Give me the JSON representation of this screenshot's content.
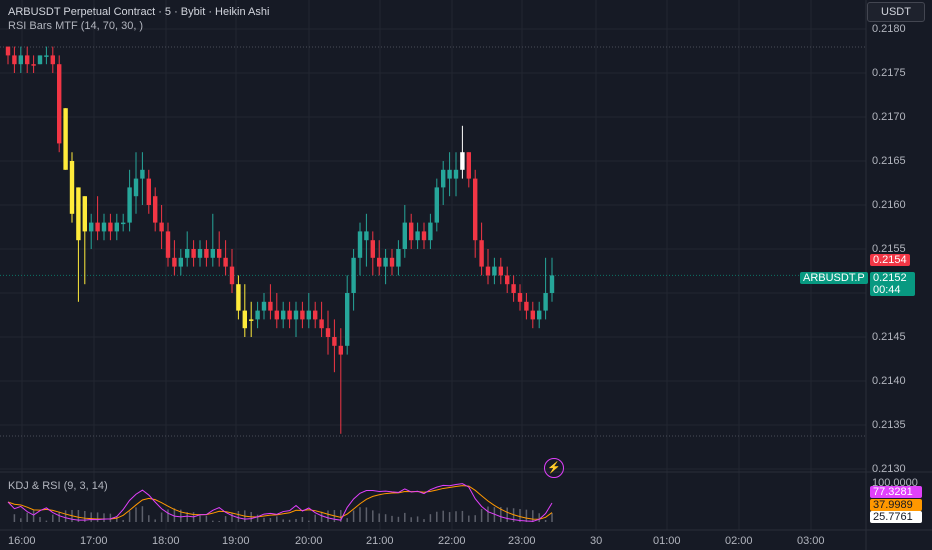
{
  "header": {
    "title": "ARBUSDT Perpetual Contract · 5 · Bybit · Heikin Ashi",
    "indicator": "RSI Bars MTF (14, 70, 30, )"
  },
  "currency_button": "USDT",
  "price_axis": {
    "labels": [
      "0.2180",
      "0.2175",
      "0.2170",
      "0.2165",
      "0.2160",
      "0.2155",
      "0.2150",
      "0.2145",
      "0.2140",
      "0.2135",
      "0.2130"
    ],
    "levels": [
      0.218,
      0.2175,
      0.217,
      0.2165,
      0.216,
      0.2155,
      0.215,
      0.2145,
      0.214,
      0.2135,
      0.213
    ]
  },
  "tags": {
    "red_price": "0.2154",
    "symbol": "ARBUSDT.P",
    "current_price": "0.2152",
    "countdown": "00:44"
  },
  "kdj": {
    "title": "KDJ & RSI (9, 3, 14)",
    "labels": [
      "100.0000",
      "77.3281",
      "37.9989",
      "25.7761"
    ]
  },
  "time_axis": [
    "16:00",
    "17:00",
    "18:00",
    "19:00",
    "20:00",
    "21:00",
    "22:00",
    "23:00",
    "30",
    "01:00",
    "02:00",
    "03:00"
  ],
  "colors": {
    "background": "#161a25",
    "bull": "#26a69a",
    "bear": "#f23645",
    "yellow": "#ffeb3b",
    "white": "#ffffff",
    "k_line": "#e040fb",
    "d_line": "#ff9800"
  },
  "chart_data": {
    "type": "candlestick",
    "timeframe": "5",
    "price_range": [
      0.213,
      0.2181
    ],
    "candles": [
      {
        "o": 0.2177,
        "h": 0.2178,
        "l": 0.2176,
        "c": 0.2178,
        "color": "bear"
      },
      {
        "o": 0.2177,
        "h": 0.2178,
        "l": 0.2175,
        "c": 0.2176,
        "color": "bear"
      },
      {
        "o": 0.2176,
        "h": 0.2178,
        "l": 0.2175,
        "c": 0.2177,
        "color": "bull"
      },
      {
        "o": 0.2177,
        "h": 0.2178,
        "l": 0.2175,
        "c": 0.2176,
        "color": "bear"
      },
      {
        "o": 0.2176,
        "h": 0.2177,
        "l": 0.2175,
        "c": 0.2176,
        "color": "bear"
      },
      {
        "o": 0.2176,
        "h": 0.2177,
        "l": 0.2176,
        "c": 0.2177,
        "color": "bull"
      },
      {
        "o": 0.2177,
        "h": 0.2178,
        "l": 0.2176,
        "c": 0.2177,
        "color": "bull"
      },
      {
        "o": 0.2177,
        "h": 0.2178,
        "l": 0.2175,
        "c": 0.2176,
        "color": "bear"
      },
      {
        "o": 0.2176,
        "h": 0.2177,
        "l": 0.2166,
        "c": 0.2167,
        "color": "bear"
      },
      {
        "o": 0.2171,
        "h": 0.2171,
        "l": 0.2164,
        "c": 0.2164,
        "color": "yellow"
      },
      {
        "o": 0.2165,
        "h": 0.2166,
        "l": 0.2158,
        "c": 0.2159,
        "color": "yellow"
      },
      {
        "o": 0.2162,
        "h": 0.2162,
        "l": 0.2149,
        "c": 0.2156,
        "color": "yellow"
      },
      {
        "o": 0.2161,
        "h": 0.2161,
        "l": 0.2151,
        "c": 0.2157,
        "color": "yellow"
      },
      {
        "o": 0.2157,
        "h": 0.2159,
        "l": 0.2155,
        "c": 0.2158,
        "color": "bull"
      },
      {
        "o": 0.2158,
        "h": 0.2161,
        "l": 0.2156,
        "c": 0.2157,
        "color": "bear"
      },
      {
        "o": 0.2157,
        "h": 0.2159,
        "l": 0.2156,
        "c": 0.2158,
        "color": "bull"
      },
      {
        "o": 0.2158,
        "h": 0.2159,
        "l": 0.2156,
        "c": 0.2157,
        "color": "bear"
      },
      {
        "o": 0.2157,
        "h": 0.2159,
        "l": 0.2156,
        "c": 0.2158,
        "color": "bull"
      },
      {
        "o": 0.2158,
        "h": 0.2159,
        "l": 0.2157,
        "c": 0.2158,
        "color": "bull"
      },
      {
        "o": 0.2158,
        "h": 0.2164,
        "l": 0.2157,
        "c": 0.2162,
        "color": "bull"
      },
      {
        "o": 0.2161,
        "h": 0.2166,
        "l": 0.2159,
        "c": 0.2163,
        "color": "bull"
      },
      {
        "o": 0.2163,
        "h": 0.2166,
        "l": 0.216,
        "c": 0.2164,
        "color": "bull"
      },
      {
        "o": 0.2163,
        "h": 0.2164,
        "l": 0.2159,
        "c": 0.216,
        "color": "bear"
      },
      {
        "o": 0.2161,
        "h": 0.2162,
        "l": 0.2157,
        "c": 0.2158,
        "color": "bear"
      },
      {
        "o": 0.2158,
        "h": 0.216,
        "l": 0.2155,
        "c": 0.2157,
        "color": "bear"
      },
      {
        "o": 0.2157,
        "h": 0.2158,
        "l": 0.2153,
        "c": 0.2154,
        "color": "bear"
      },
      {
        "o": 0.2154,
        "h": 0.2156,
        "l": 0.2152,
        "c": 0.2153,
        "color": "bear"
      },
      {
        "o": 0.2153,
        "h": 0.2155,
        "l": 0.2152,
        "c": 0.2154,
        "color": "bull"
      },
      {
        "o": 0.2154,
        "h": 0.2157,
        "l": 0.2153,
        "c": 0.2155,
        "color": "bull"
      },
      {
        "o": 0.2155,
        "h": 0.2156,
        "l": 0.2153,
        "c": 0.2154,
        "color": "bear"
      },
      {
        "o": 0.2154,
        "h": 0.2156,
        "l": 0.2153,
        "c": 0.2155,
        "color": "bull"
      },
      {
        "o": 0.2155,
        "h": 0.2156,
        "l": 0.2153,
        "c": 0.2154,
        "color": "bear"
      },
      {
        "o": 0.2154,
        "h": 0.2159,
        "l": 0.2153,
        "c": 0.2155,
        "color": "bull"
      },
      {
        "o": 0.2155,
        "h": 0.2157,
        "l": 0.2153,
        "c": 0.2154,
        "color": "bear"
      },
      {
        "o": 0.2154,
        "h": 0.2156,
        "l": 0.2152,
        "c": 0.2153,
        "color": "bear"
      },
      {
        "o": 0.2153,
        "h": 0.2155,
        "l": 0.215,
        "c": 0.2151,
        "color": "bear"
      },
      {
        "o": 0.2151,
        "h": 0.2152,
        "l": 0.2147,
        "c": 0.2148,
        "color": "yellow"
      },
      {
        "o": 0.2148,
        "h": 0.2151,
        "l": 0.2145,
        "c": 0.2146,
        "color": "yellow"
      },
      {
        "o": 0.2147,
        "h": 0.2149,
        "l": 0.2145,
        "c": 0.2147,
        "color": "yellow"
      },
      {
        "o": 0.2147,
        "h": 0.2149,
        "l": 0.2146,
        "c": 0.2148,
        "color": "bull"
      },
      {
        "o": 0.2148,
        "h": 0.215,
        "l": 0.2147,
        "c": 0.2149,
        "color": "bull"
      },
      {
        "o": 0.2149,
        "h": 0.2151,
        "l": 0.2147,
        "c": 0.2148,
        "color": "bear"
      },
      {
        "o": 0.2148,
        "h": 0.215,
        "l": 0.2146,
        "c": 0.2147,
        "color": "bear"
      },
      {
        "o": 0.2147,
        "h": 0.2149,
        "l": 0.2146,
        "c": 0.2148,
        "color": "bull"
      },
      {
        "o": 0.2148,
        "h": 0.2149,
        "l": 0.2146,
        "c": 0.2147,
        "color": "bear"
      },
      {
        "o": 0.2147,
        "h": 0.2149,
        "l": 0.2145,
        "c": 0.2148,
        "color": "bull"
      },
      {
        "o": 0.2148,
        "h": 0.2149,
        "l": 0.2146,
        "c": 0.2147,
        "color": "bear"
      },
      {
        "o": 0.2147,
        "h": 0.215,
        "l": 0.2146,
        "c": 0.2148,
        "color": "bull"
      },
      {
        "o": 0.2148,
        "h": 0.2149,
        "l": 0.2146,
        "c": 0.2147,
        "color": "bear"
      },
      {
        "o": 0.2147,
        "h": 0.2149,
        "l": 0.2145,
        "c": 0.2146,
        "color": "bear"
      },
      {
        "o": 0.2146,
        "h": 0.2148,
        "l": 0.2143,
        "c": 0.2145,
        "color": "bear"
      },
      {
        "o": 0.2145,
        "h": 0.2147,
        "l": 0.2141,
        "c": 0.2144,
        "color": "bear"
      },
      {
        "o": 0.2144,
        "h": 0.2146,
        "l": 0.2134,
        "c": 0.2143,
        "color": "bear"
      },
      {
        "o": 0.2144,
        "h": 0.2152,
        "l": 0.2143,
        "c": 0.215,
        "color": "bull"
      },
      {
        "o": 0.215,
        "h": 0.2155,
        "l": 0.2148,
        "c": 0.2154,
        "color": "bull"
      },
      {
        "o": 0.2154,
        "h": 0.2158,
        "l": 0.2152,
        "c": 0.2157,
        "color": "bull"
      },
      {
        "o": 0.2157,
        "h": 0.2159,
        "l": 0.2153,
        "c": 0.2156,
        "color": "bull"
      },
      {
        "o": 0.2156,
        "h": 0.2157,
        "l": 0.2152,
        "c": 0.2154,
        "color": "bear"
      },
      {
        "o": 0.2154,
        "h": 0.2156,
        "l": 0.2152,
        "c": 0.2153,
        "color": "bear"
      },
      {
        "o": 0.2153,
        "h": 0.2155,
        "l": 0.2151,
        "c": 0.2154,
        "color": "bull"
      },
      {
        "o": 0.2154,
        "h": 0.2155,
        "l": 0.2152,
        "c": 0.2153,
        "color": "bear"
      },
      {
        "o": 0.2153,
        "h": 0.2156,
        "l": 0.2152,
        "c": 0.2155,
        "color": "bull"
      },
      {
        "o": 0.2155,
        "h": 0.216,
        "l": 0.2154,
        "c": 0.2158,
        "color": "bull"
      },
      {
        "o": 0.2158,
        "h": 0.2159,
        "l": 0.2155,
        "c": 0.2156,
        "color": "bear"
      },
      {
        "o": 0.2156,
        "h": 0.2158,
        "l": 0.2155,
        "c": 0.2157,
        "color": "bull"
      },
      {
        "o": 0.2157,
        "h": 0.2158,
        "l": 0.2155,
        "c": 0.2156,
        "color": "bear"
      },
      {
        "o": 0.2156,
        "h": 0.2159,
        "l": 0.2155,
        "c": 0.2158,
        "color": "bull"
      },
      {
        "o": 0.2158,
        "h": 0.2163,
        "l": 0.2157,
        "c": 0.2162,
        "color": "bull"
      },
      {
        "o": 0.2162,
        "h": 0.2165,
        "l": 0.216,
        "c": 0.2164,
        "color": "bull"
      },
      {
        "o": 0.2164,
        "h": 0.2166,
        "l": 0.2161,
        "c": 0.2163,
        "color": "bull"
      },
      {
        "o": 0.2163,
        "h": 0.2166,
        "l": 0.2161,
        "c": 0.2164,
        "color": "bull"
      },
      {
        "o": 0.2164,
        "h": 0.2169,
        "l": 0.2163,
        "c": 0.2166,
        "color": "white"
      },
      {
        "o": 0.2166,
        "h": 0.2166,
        "l": 0.2162,
        "c": 0.2163,
        "color": "bear"
      },
      {
        "o": 0.2163,
        "h": 0.2164,
        "l": 0.2154,
        "c": 0.2156,
        "color": "bear"
      },
      {
        "o": 0.2156,
        "h": 0.2158,
        "l": 0.2152,
        "c": 0.2153,
        "color": "bear"
      },
      {
        "o": 0.2153,
        "h": 0.2155,
        "l": 0.2151,
        "c": 0.2152,
        "color": "bear"
      },
      {
        "o": 0.2152,
        "h": 0.2154,
        "l": 0.2151,
        "c": 0.2153,
        "color": "bull"
      },
      {
        "o": 0.2153,
        "h": 0.2154,
        "l": 0.2151,
        "c": 0.2152,
        "color": "bear"
      },
      {
        "o": 0.2152,
        "h": 0.2153,
        "l": 0.215,
        "c": 0.2151,
        "color": "bear"
      },
      {
        "o": 0.2151,
        "h": 0.2152,
        "l": 0.2149,
        "c": 0.215,
        "color": "bear"
      },
      {
        "o": 0.215,
        "h": 0.2151,
        "l": 0.2148,
        "c": 0.2149,
        "color": "bear"
      },
      {
        "o": 0.2149,
        "h": 0.215,
        "l": 0.2147,
        "c": 0.2148,
        "color": "bear"
      },
      {
        "o": 0.2148,
        "h": 0.2149,
        "l": 0.2146,
        "c": 0.2147,
        "color": "bear"
      },
      {
        "o": 0.2147,
        "h": 0.2149,
        "l": 0.2146,
        "c": 0.2148,
        "color": "bull"
      },
      {
        "o": 0.2148,
        "h": 0.2154,
        "l": 0.2147,
        "c": 0.215,
        "color": "bull"
      },
      {
        "o": 0.215,
        "h": 0.2154,
        "l": 0.2149,
        "c": 0.2152,
        "color": "bull"
      }
    ]
  }
}
